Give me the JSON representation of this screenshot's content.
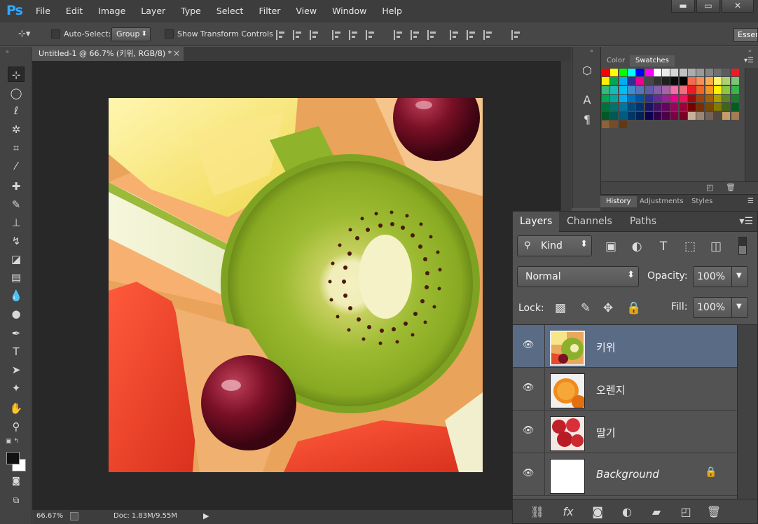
{
  "app": {
    "logo": "Ps"
  },
  "menu": [
    "File",
    "Edit",
    "Image",
    "Layer",
    "Type",
    "Select",
    "Filter",
    "View",
    "Window",
    "Help"
  ],
  "window_controls": {
    "minimize": "▬",
    "maximize": "▭",
    "close": "✕"
  },
  "options_bar": {
    "auto_select_label": "Auto-Select:",
    "auto_select_value": "Group",
    "show_transform_label": "Show Transform Controls",
    "workspace_label": "Essentials"
  },
  "document": {
    "tab_title": "Untitled-1 @ 66.7% (키위, RGB/8) *",
    "close_glyph": "×",
    "zoom_readout": "66.67%",
    "doc_size": "Doc: 1.83M/9.55M"
  },
  "swatch_panel": {
    "tabs": [
      "Color",
      "Swatches"
    ],
    "active": "Swatches"
  },
  "history_panel": {
    "tabs": [
      "History",
      "Adjustments",
      "Styles"
    ],
    "active": "History"
  },
  "layers_panel": {
    "tabs": [
      "Layers",
      "Channels",
      "Paths"
    ],
    "active_tab": "Layers",
    "filter_kind": "Kind",
    "blend_mode": "Normal",
    "opacity_label": "Opacity:",
    "opacity_value": "100%",
    "lock_label": "Lock:",
    "fill_label": "Fill:",
    "fill_value": "100%",
    "layers": [
      {
        "name": "키위",
        "selected": true,
        "thumb": "kiwi-thumbnail"
      },
      {
        "name": "오렌지",
        "selected": false,
        "thumb": "orange-thumbnail"
      },
      {
        "name": "딸기",
        "selected": false,
        "thumb": "strawberry-thumbnail"
      },
      {
        "name": "Background",
        "selected": false,
        "thumb": "white-thumbnail",
        "locked": true
      }
    ]
  },
  "colors": {
    "ps_blue": "#31a8ff",
    "selection": "#5a6b85",
    "canvas_bg": "#282828"
  }
}
